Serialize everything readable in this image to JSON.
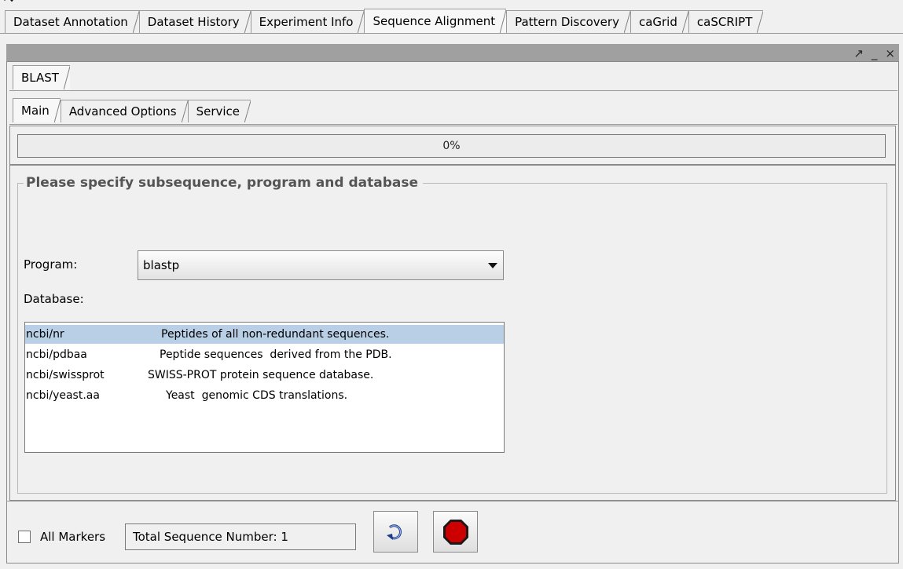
{
  "top_tabs": [
    "Dataset Annotation",
    "Dataset History",
    "Experiment Info",
    "Sequence Alignment",
    "Pattern Discovery",
    "caGrid",
    "caSCRIPT"
  ],
  "active_top_tab": "Sequence Alignment",
  "window_controls": {
    "maximize": "↗",
    "minimize": "_",
    "close": "×"
  },
  "tool_tab": "BLAST",
  "sub_tabs": [
    "Main",
    "Advanced Options",
    "Service"
  ],
  "progress": {
    "text": "0%",
    "value": 0
  },
  "group_title": "Please specify subsequence, program and database",
  "program": {
    "label": "Program:",
    "value": "blastp"
  },
  "database": {
    "label": "Database:",
    "items": [
      {
        "name": "ncbi/nr",
        "description": "Peptides of all non-redundant sequences.",
        "selected": true
      },
      {
        "name": "ncbi/pdbaa",
        "description": "Peptide sequences  derived from the PDB.",
        "selected": false
      },
      {
        "name": "ncbi/swissprot",
        "description": "SWISS-PROT protein sequence database.",
        "selected": false
      },
      {
        "name": "ncbi/yeast.aa",
        "description": "Yeast  genomic CDS translations.",
        "selected": false
      }
    ]
  },
  "bottom": {
    "all_markers_label": "All Markers",
    "all_markers_checked": false,
    "sequence_count": "Total Sequence Number: 1"
  },
  "icons": {
    "refresh": "refresh-icon",
    "stop": "stop-icon"
  },
  "colors": {
    "selection": "#b8cfe5",
    "stop_red": "#cc0000",
    "panel_bar": "#a0a0a0"
  }
}
